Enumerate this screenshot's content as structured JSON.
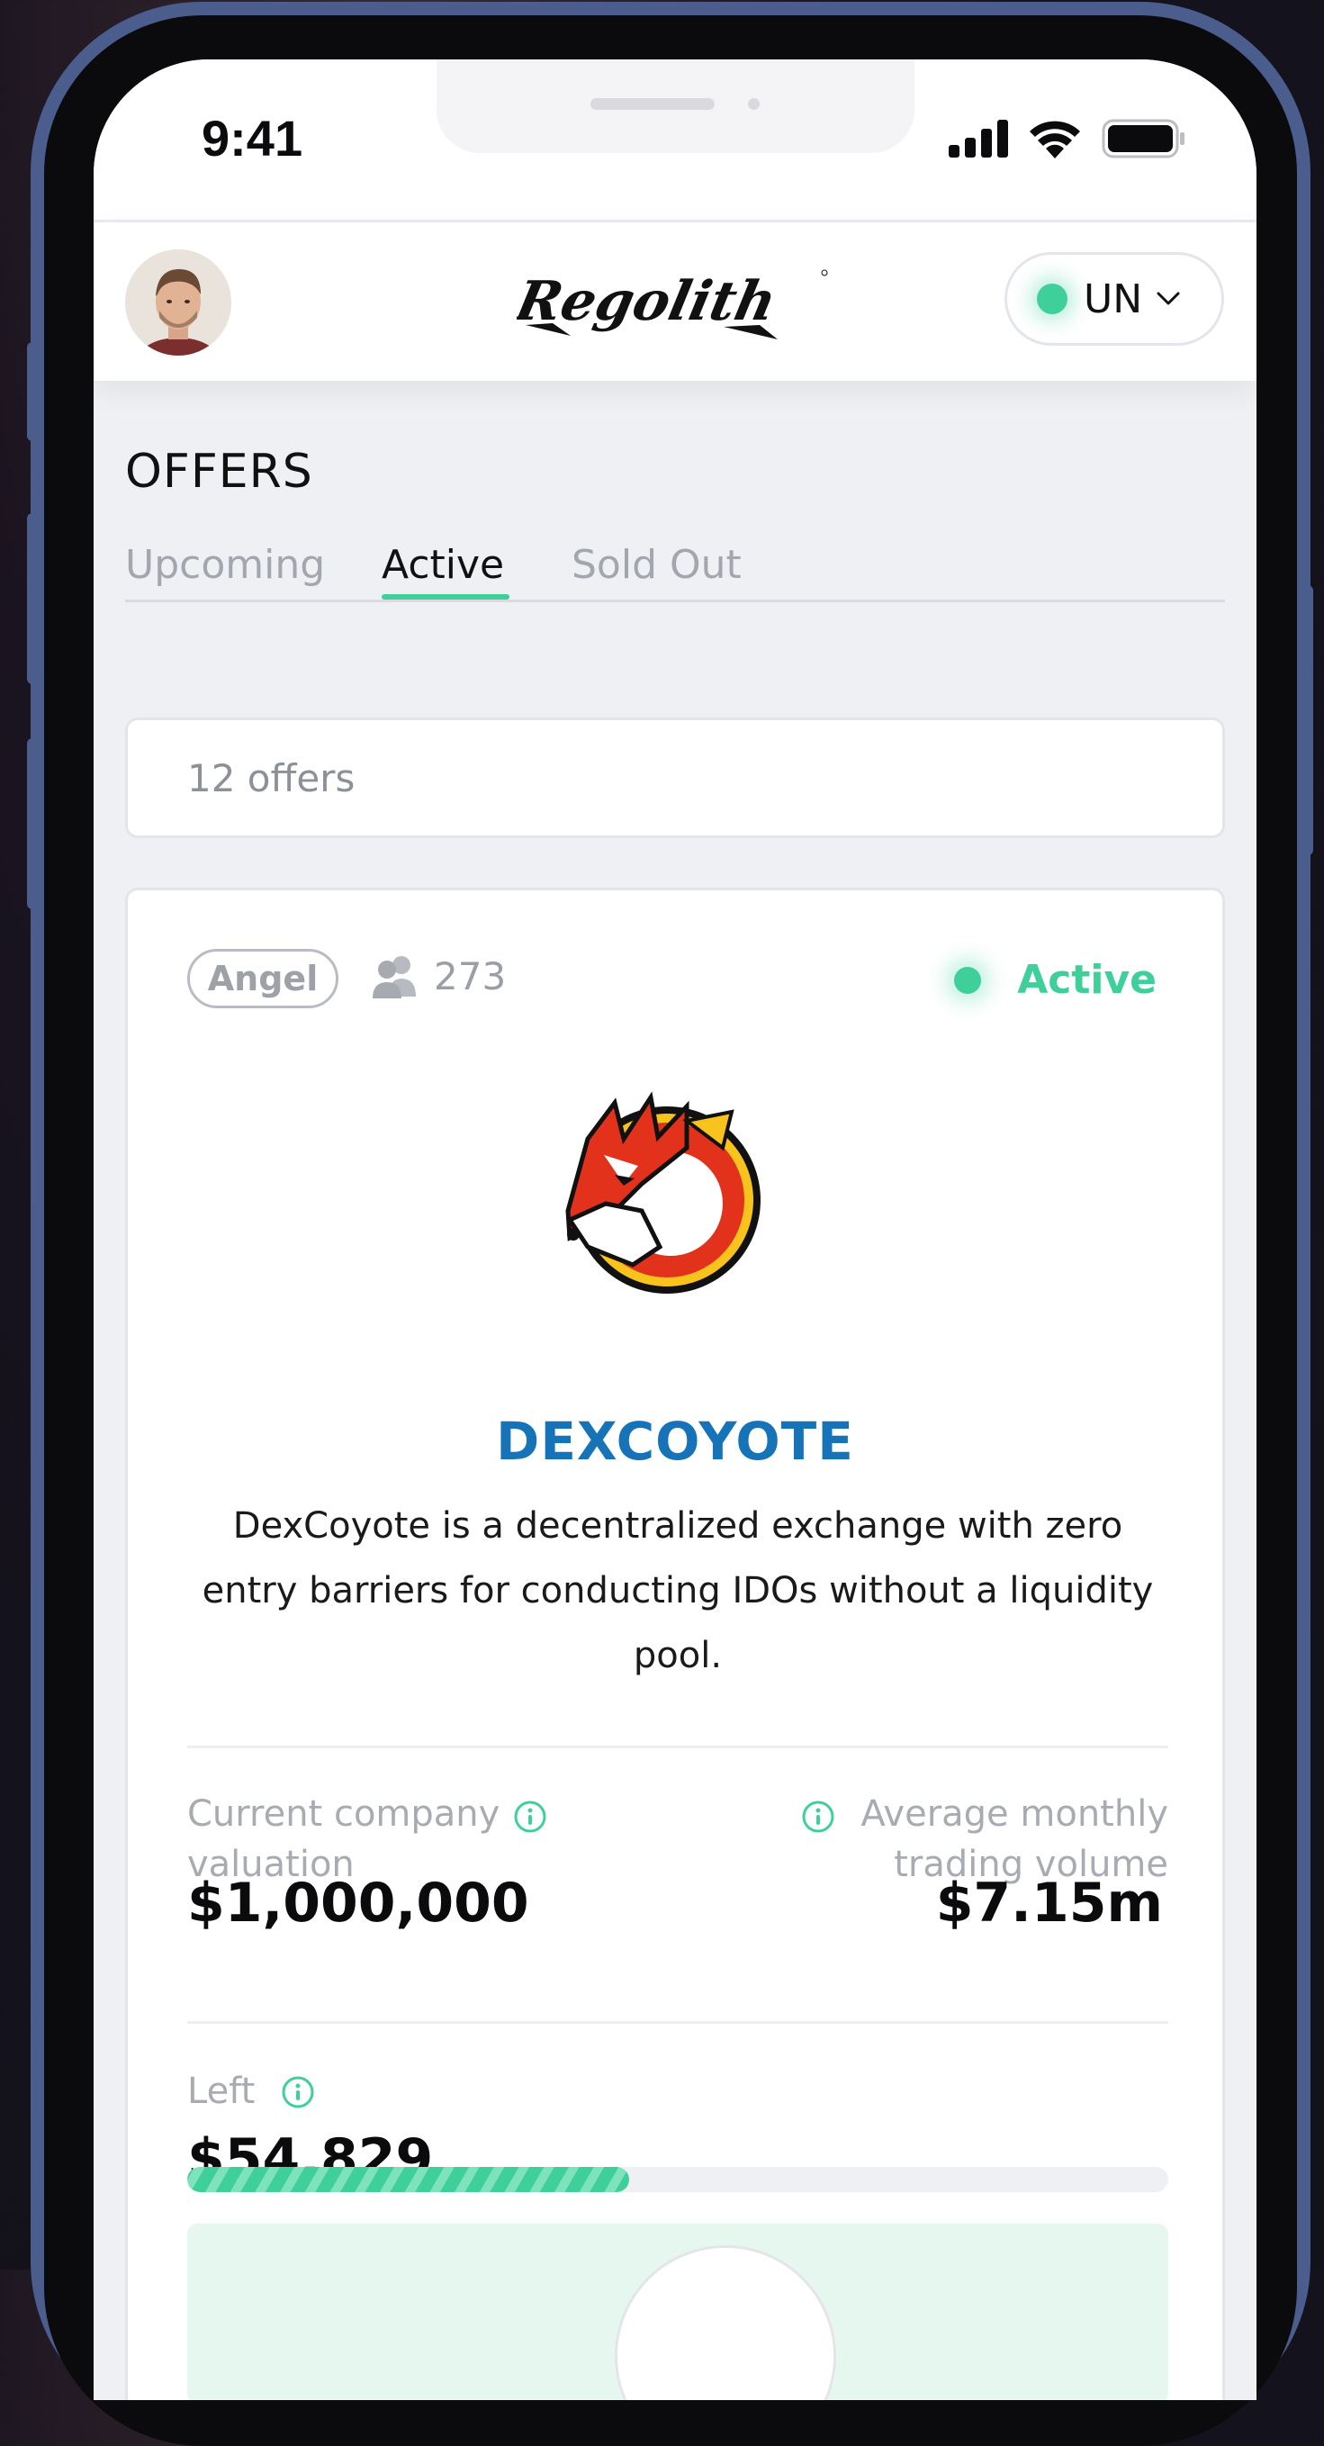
{
  "status_bar": {
    "time": "9:41"
  },
  "header": {
    "brand": "Regolith",
    "language": {
      "code": "UN",
      "status_color": "#3fcf9b"
    }
  },
  "page": {
    "title": "OFFERS",
    "tabs": [
      {
        "label": "Upcoming",
        "active": false
      },
      {
        "label": "Active",
        "active": true
      },
      {
        "label": "Sold Out",
        "active": false
      }
    ],
    "offers_count": "12 offers"
  },
  "offer": {
    "category": "Angel",
    "investors": "273",
    "status": "Active",
    "company_name": "DEXCOYOTE",
    "description": "DexCoyote is a decentralized exchange with zero entry barriers for conducting IDOs without a liquidity pool.",
    "valuation_label": "Current company valuation",
    "valuation_value": "$1,000,000",
    "volume_label": "Average monthly trading volume",
    "volume_value": "$7.15m",
    "left_label": "Left",
    "left_value": "$54,829",
    "progress_fraction": 0.45
  },
  "colors": {
    "accent": "#3fcf9b",
    "brand_blue": "#1673b8",
    "frame": "#4a5d8c"
  }
}
